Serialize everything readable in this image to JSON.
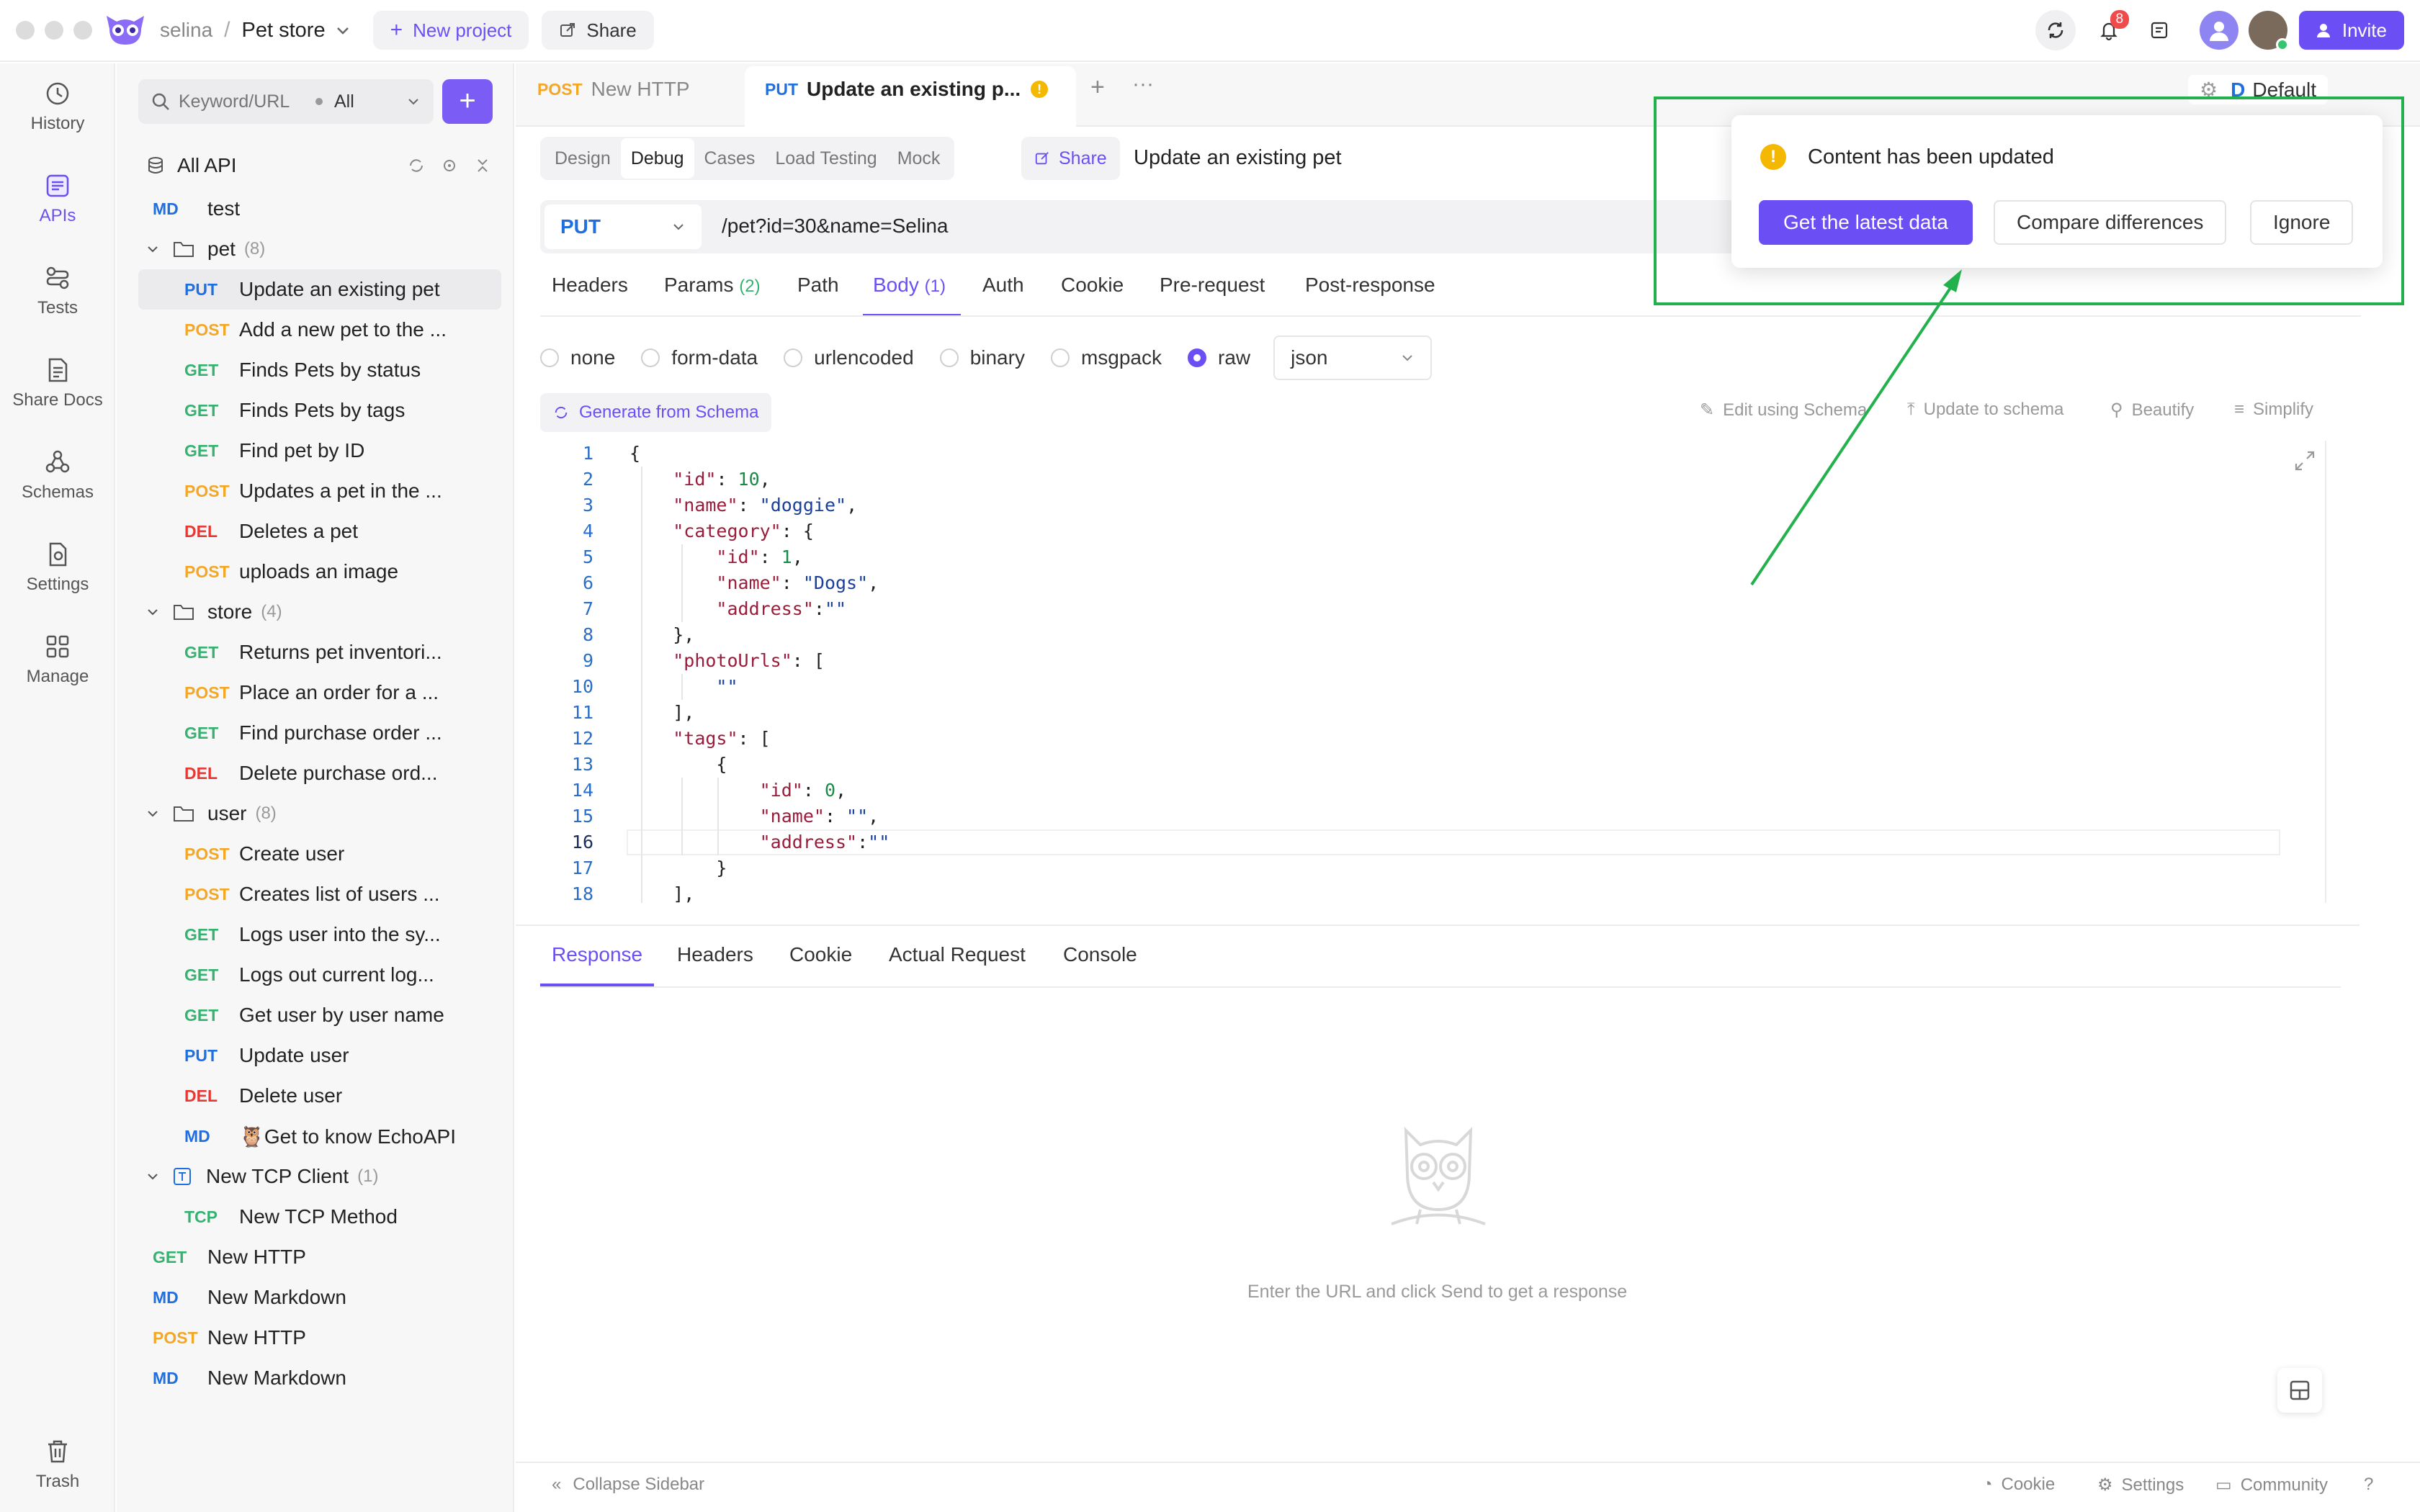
{
  "topbar": {
    "workspace": "selina",
    "separator": "/",
    "project": "Pet store",
    "new_project": "New project",
    "share": "Share",
    "notif_count": "8",
    "invite": "Invite"
  },
  "leftnav": [
    {
      "label": "History",
      "icon": "history-icon"
    },
    {
      "label": "APIs",
      "icon": "apis-icon"
    },
    {
      "label": "Tests",
      "icon": "tests-icon"
    },
    {
      "label": "Share Docs",
      "icon": "share-docs-icon"
    },
    {
      "label": "Schemas",
      "icon": "schemas-icon"
    },
    {
      "label": "Settings",
      "icon": "settings-icon"
    },
    {
      "label": "Manage",
      "icon": "manage-icon"
    },
    {
      "label": "Trash",
      "icon": "trash-icon"
    }
  ],
  "sidebar": {
    "search_placeholder": "Keyword/URL",
    "filter": "All",
    "all_api": "All API",
    "items": [
      {
        "method": "MD",
        "name": "test"
      },
      {
        "folder": "pet",
        "count": "(8)"
      },
      {
        "method": "PUT",
        "name": "Update an existing pet"
      },
      {
        "method": "POST",
        "name": "Add a new pet to the ..."
      },
      {
        "method": "GET",
        "name": "Finds Pets by status"
      },
      {
        "method": "GET",
        "name": "Finds Pets by tags"
      },
      {
        "method": "GET",
        "name": "Find pet by ID"
      },
      {
        "method": "POST",
        "name": "Updates a pet in the ..."
      },
      {
        "method": "DEL",
        "name": "Deletes a pet"
      },
      {
        "method": "POST",
        "name": "uploads an image"
      },
      {
        "folder": "store",
        "count": "(4)"
      },
      {
        "method": "GET",
        "name": "Returns pet inventori..."
      },
      {
        "method": "POST",
        "name": "Place an order for a ..."
      },
      {
        "method": "GET",
        "name": "Find purchase order ..."
      },
      {
        "method": "DEL",
        "name": "Delete purchase ord..."
      },
      {
        "folder": "user",
        "count": "(8)"
      },
      {
        "method": "POST",
        "name": "Create user"
      },
      {
        "method": "POST",
        "name": "Creates list of users ..."
      },
      {
        "method": "GET",
        "name": "Logs user into the sy..."
      },
      {
        "method": "GET",
        "name": "Logs out current log..."
      },
      {
        "method": "GET",
        "name": "Get user by user name"
      },
      {
        "method": "PUT",
        "name": "Update user"
      },
      {
        "method": "DEL",
        "name": "Delete user"
      },
      {
        "method": "MD",
        "name": "🦉Get to know EchoAPI"
      },
      {
        "folder": "New TCP Client",
        "count": "(1)"
      },
      {
        "method": "TCP",
        "name": "New TCP Method"
      },
      {
        "method": "GET",
        "name": "New HTTP"
      },
      {
        "method": "MD",
        "name": "New Markdown"
      },
      {
        "method": "POST",
        "name": "New HTTP"
      },
      {
        "method": "MD",
        "name": "New Markdown"
      }
    ]
  },
  "tabs": [
    {
      "method": "POST",
      "label": "New HTTP"
    },
    {
      "method": "PUT",
      "label": "Update an existing p..."
    }
  ],
  "env": "Default",
  "subtabs": [
    "Design",
    "Debug",
    "Cases",
    "Load Testing",
    "Mock"
  ],
  "share_label": "Share",
  "api_title": "Update an existing pet",
  "method_select": "PUT",
  "url": "/pet?id=30&name=Selina",
  "request_tabs": [
    {
      "label": "Headers"
    },
    {
      "label": "Params",
      "count": "(2)"
    },
    {
      "label": "Path"
    },
    {
      "label": "Body",
      "count": "(1)"
    },
    {
      "label": "Auth"
    },
    {
      "label": "Cookie"
    },
    {
      "label": "Pre-request"
    },
    {
      "label": "Post-response"
    }
  ],
  "body_types": [
    "none",
    "form-data",
    "urlencoded",
    "binary",
    "msgpack",
    "raw"
  ],
  "format": "json",
  "generate": "Generate from Schema",
  "tool_actions": [
    "Edit using Schema",
    "Update to schema",
    "Beautify",
    "Simplify"
  ],
  "code_lines": [
    "{",
    "    \"id\": 10,",
    "    \"name\": \"doggie\",",
    "    \"category\": {",
    "        \"id\": 1,",
    "        \"name\": \"Dogs\",",
    "        \"address\":\"\"",
    "    },",
    "    \"photoUrls\": [",
    "        \"\"",
    "    ],",
    "    \"tags\": [",
    "        {",
    "            \"id\": 0,",
    "            \"name\": \"\",",
    "            \"address\":\"\"",
    "        }",
    "    ],"
  ],
  "response_tabs": [
    "Response",
    "Headers",
    "Cookie",
    "Actual Request",
    "Console"
  ],
  "empty_response": "Enter the URL and click Send to get a response",
  "footer": {
    "collapse": "Collapse Sidebar",
    "cookie": "Cookie",
    "settings": "Settings",
    "community": "Community"
  },
  "popup": {
    "message": "Content has been updated",
    "latest": "Get the latest data",
    "compare": "Compare differences",
    "ignore": "Ignore"
  },
  "colors": {
    "accent": "#6c4ef5",
    "highlight": "#22b14c",
    "warning": "#f5b800"
  }
}
